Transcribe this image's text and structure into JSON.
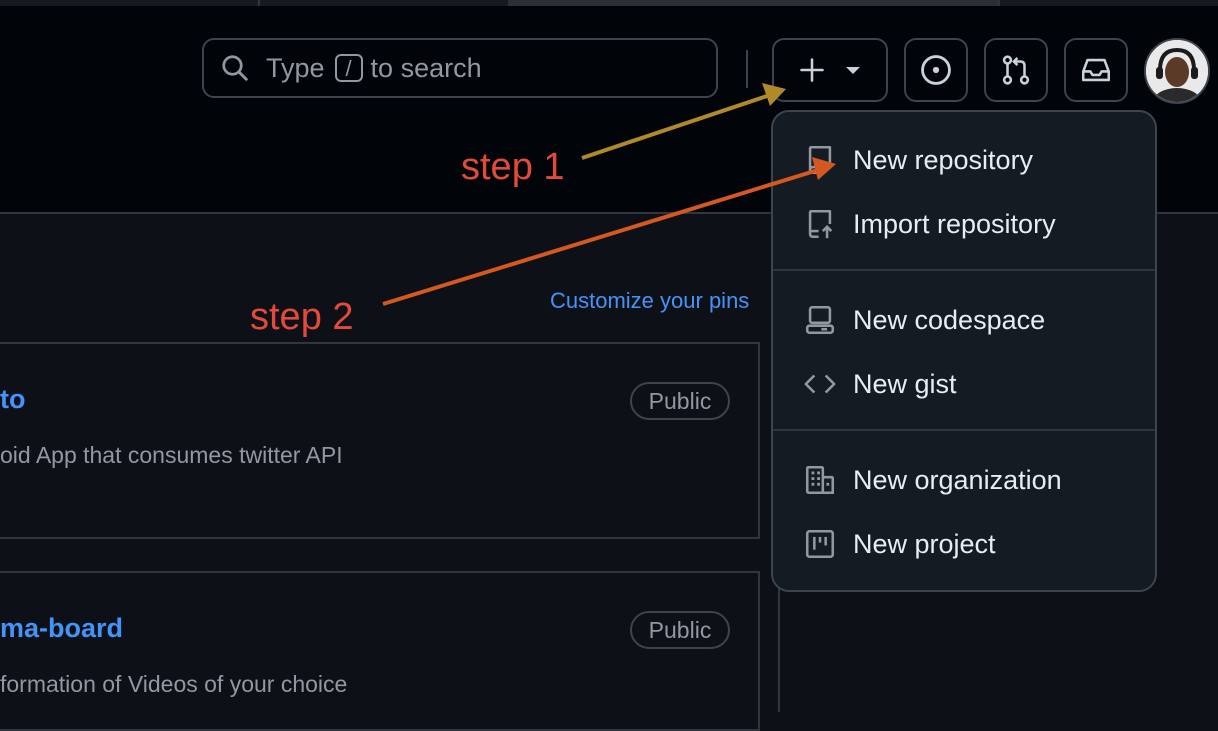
{
  "header": {
    "search_prefix": "Type",
    "search_key": "/",
    "search_suffix": "to search",
    "icons": [
      "plus-icon",
      "caret-down-icon",
      "issue-opened-icon",
      "git-pull-request-icon",
      "inbox-icon"
    ]
  },
  "annotations": {
    "step1": "step 1",
    "step2": "step 2",
    "color": "#e44a3a",
    "arrow1_color": "#b08a2a",
    "arrow2_color": "#d4581f"
  },
  "pins": {
    "customize_label": "Customize your pins"
  },
  "cards": [
    {
      "name_fragment": "to",
      "badge": "Public",
      "desc_fragment": "oid App that consumes twitter API"
    },
    {
      "name_fragment": "ma-board",
      "badge": "Public",
      "desc_fragment": "formation of Videos of your choice"
    }
  ],
  "menu": {
    "items": [
      {
        "label": "New repository",
        "icon": "repo-icon"
      },
      {
        "label": "Import repository",
        "icon": "repo-push-icon"
      },
      {
        "label": "New codespace",
        "icon": "codespaces-icon"
      },
      {
        "label": "New gist",
        "icon": "code-icon"
      },
      {
        "label": "New organization",
        "icon": "organization-icon"
      },
      {
        "label": "New project",
        "icon": "project-icon"
      }
    ]
  },
  "colors": {
    "background": "#0d1117",
    "header": "#010409",
    "border": "#3d444d",
    "link": "#4493f8",
    "text": "#e6edf3",
    "muted": "#9198a1"
  }
}
